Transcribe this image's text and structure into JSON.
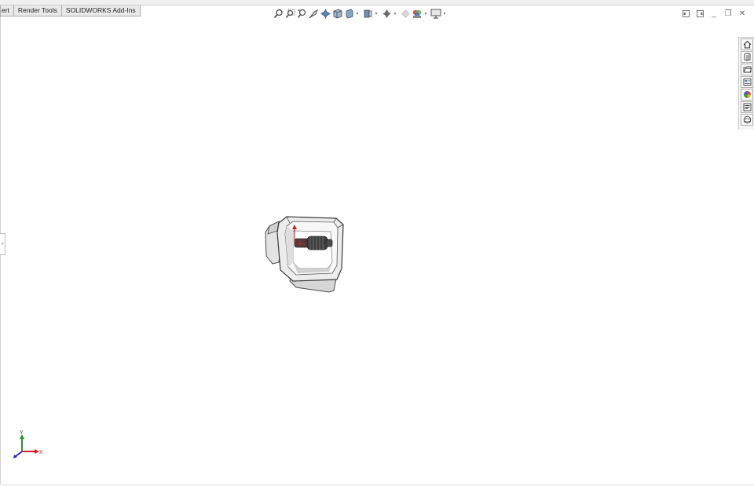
{
  "tabs": [
    {
      "label": "ert"
    },
    {
      "label": "Render Tools"
    },
    {
      "label": "SOLIDWORKS Add-Ins"
    }
  ],
  "hud": {
    "buttons": [
      {
        "icon": "zoom-to-fit-icon"
      },
      {
        "icon": "zoom-to-area-icon"
      },
      {
        "icon": "previous-view-icon"
      },
      {
        "icon": "section-view-icon"
      },
      {
        "icon": "dynamic-annotation-icon"
      },
      {
        "icon": "view-orientation-icon"
      },
      {
        "icon": "display-style-icon"
      },
      {
        "icon": "hide-show-items-icon"
      },
      {
        "icon": "edit-appearance-icon"
      },
      {
        "icon": "apply-scene-icon"
      },
      {
        "icon": "view-settings-icon"
      },
      {
        "icon": "display-pane-icon"
      }
    ]
  },
  "window_controls": [
    {
      "icon": "tile-left-icon"
    },
    {
      "icon": "tile-right-icon"
    },
    {
      "icon": "minimize-icon",
      "glyph": "_"
    },
    {
      "icon": "restore-icon",
      "glyph": "❐"
    },
    {
      "icon": "close-icon",
      "glyph": "✕"
    }
  ],
  "task_pane": [
    {
      "icon": "home-icon"
    },
    {
      "icon": "design-library-icon"
    },
    {
      "icon": "file-explorer-icon"
    },
    {
      "icon": "view-palette-icon"
    },
    {
      "icon": "appearances-icon"
    },
    {
      "icon": "custom-properties-icon"
    },
    {
      "icon": "solidworks-forum-icon"
    }
  ],
  "triad": {
    "y_label": "Y",
    "x_label": "X",
    "colors": {
      "x": "#d21f1f",
      "y": "#1e9a2e",
      "z": "#2a2ad6"
    }
  },
  "left_handle_glyph": "»"
}
